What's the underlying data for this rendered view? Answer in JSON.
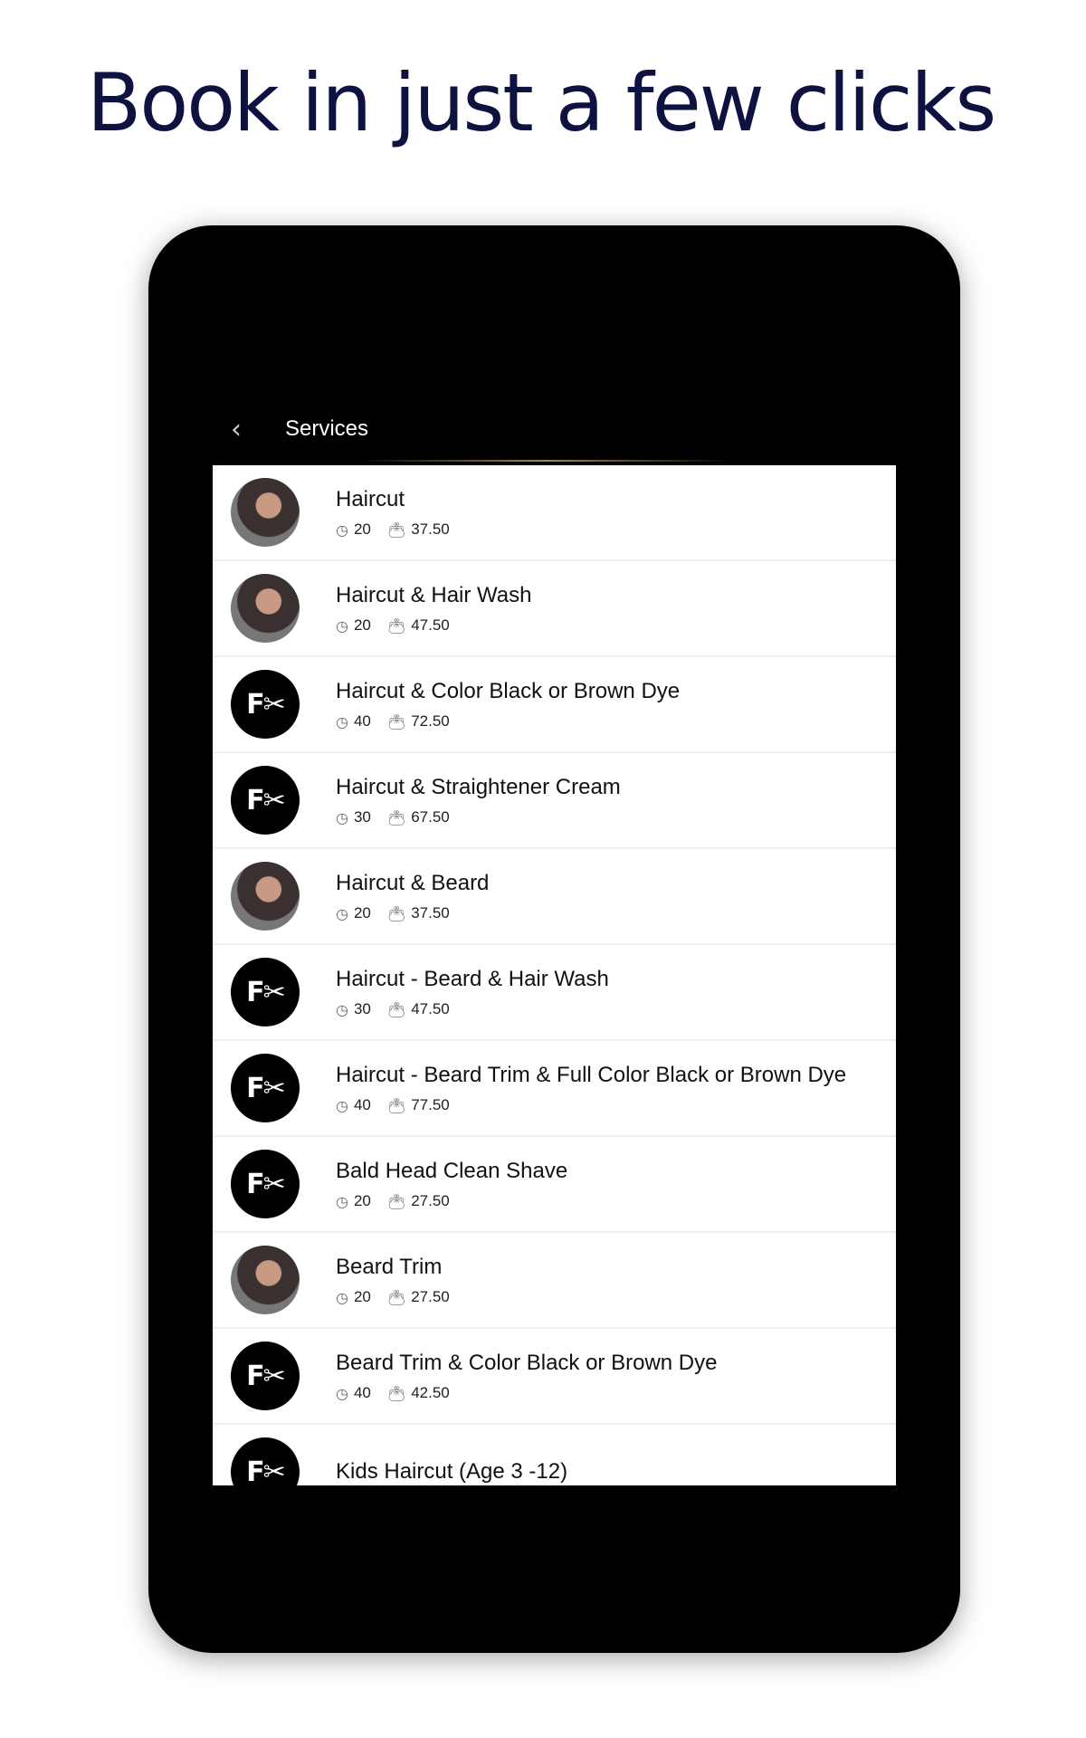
{
  "headline": "Book in just a few clicks",
  "header": {
    "title": "Services",
    "back_icon": "chevron-left-icon"
  },
  "services": [
    {
      "name": "Haircut",
      "duration": "20",
      "price": "37.50",
      "avatar": "photo"
    },
    {
      "name": "Haircut & Hair Wash",
      "duration": "20",
      "price": "47.50",
      "avatar": "photo"
    },
    {
      "name": "Haircut & Color Black or Brown Dye",
      "duration": "40",
      "price": "72.50",
      "avatar": "logo"
    },
    {
      "name": "Haircut & Straightener Cream",
      "duration": "30",
      "price": "67.50",
      "avatar": "logo"
    },
    {
      "name": "Haircut & Beard",
      "duration": "20",
      "price": "37.50",
      "avatar": "photo"
    },
    {
      "name": "Haircut - Beard & Hair Wash",
      "duration": "30",
      "price": "47.50",
      "avatar": "logo"
    },
    {
      "name": "Haircut - Beard Trim & Full Color Black or Brown Dye",
      "duration": "40",
      "price": "77.50",
      "avatar": "logo"
    },
    {
      "name": "Bald Head Clean Shave",
      "duration": "20",
      "price": "27.50",
      "avatar": "logo"
    },
    {
      "name": "Beard Trim",
      "duration": "20",
      "price": "27.50",
      "avatar": "photo"
    },
    {
      "name": "Beard Trim & Color Black or Brown Dye",
      "duration": "40",
      "price": "42.50",
      "avatar": "logo"
    },
    {
      "name": "Kids Haircut (Age 3 -12)",
      "avatar": "logo"
    }
  ],
  "icons": {
    "duration": "clock-icon",
    "price": "wallet-icon"
  },
  "logo_glyph": "F✂"
}
